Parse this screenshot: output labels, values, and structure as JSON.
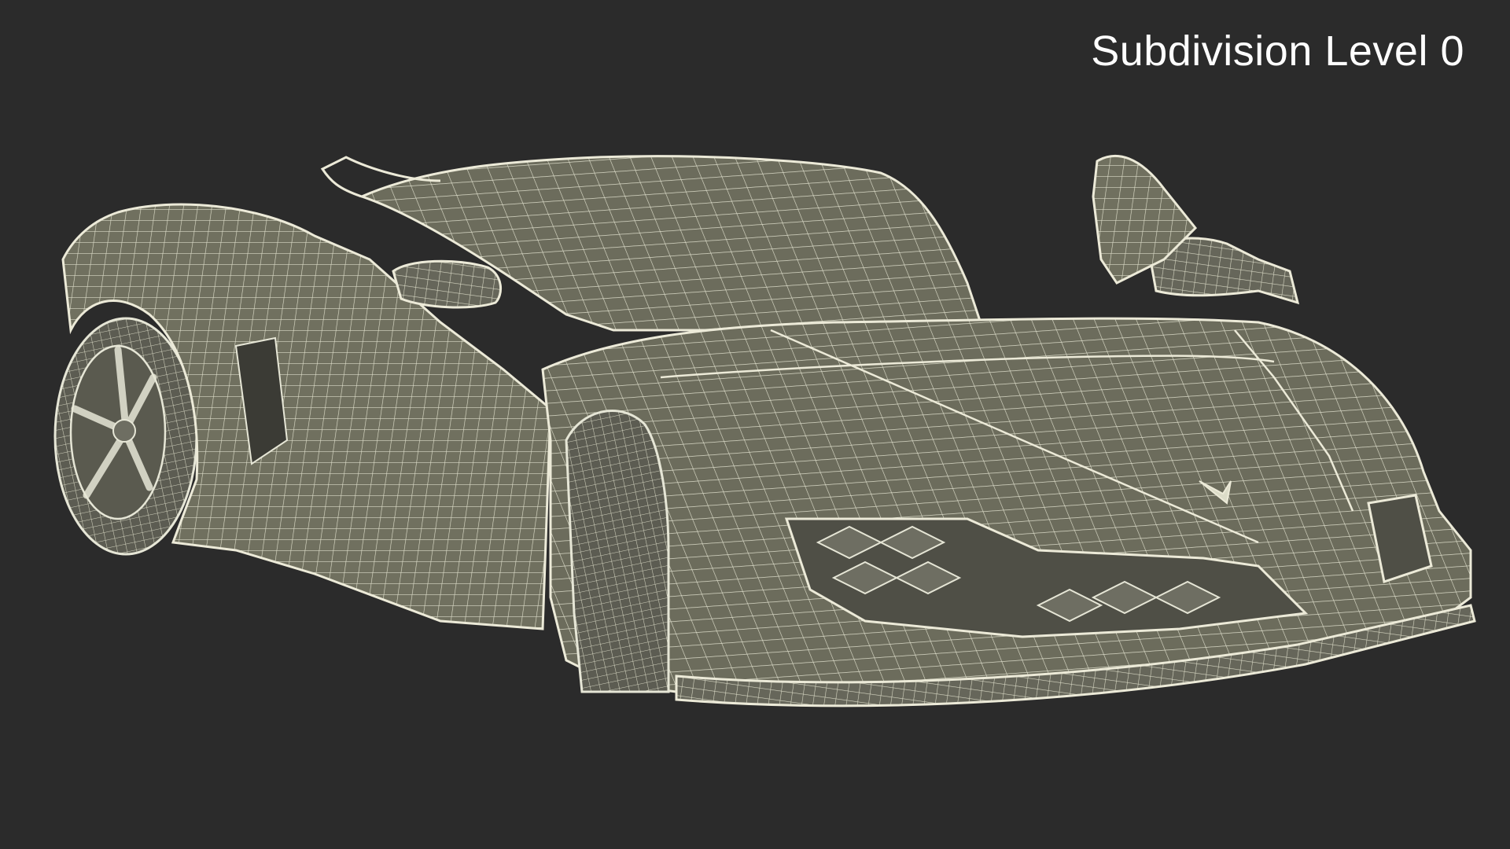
{
  "overlay": {
    "label": "Subdivision Level 0"
  },
  "scene": {
    "subject": "sports car wireframe render",
    "background_color": "#2b2b2b",
    "mesh_fill_color": "#6e6e62",
    "wire_color": "#e6e6d6"
  }
}
